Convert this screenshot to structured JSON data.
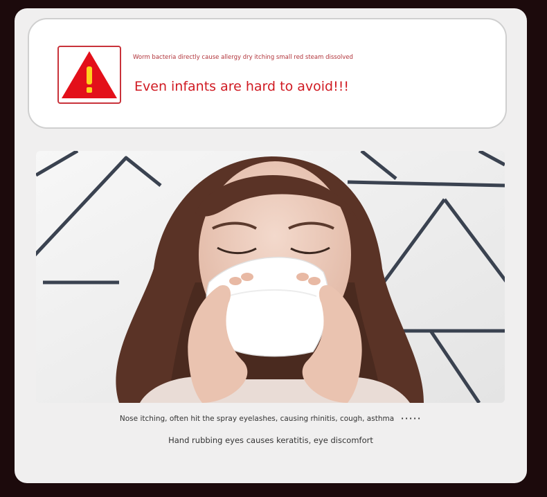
{
  "warning": {
    "icon": "warning-triangle-icon",
    "subtitle": "Worm bacteria directly cause allergy dry itching small red steam dissolved",
    "title": "Even infants are hard to avoid!!!"
  },
  "photo": {
    "subject": "woman-blowing-nose-image"
  },
  "captions": {
    "line1": "Nose itching, often hit the spray eyelashes, causing rhinitis, cough, asthma",
    "line1_suffix": "·····",
    "line2": "Hand rubbing eyes causes keratitis, eye discomfort"
  },
  "colors": {
    "accent_red": "#d01a22",
    "background": "#1c0a0c",
    "panel": "#f0efef"
  }
}
